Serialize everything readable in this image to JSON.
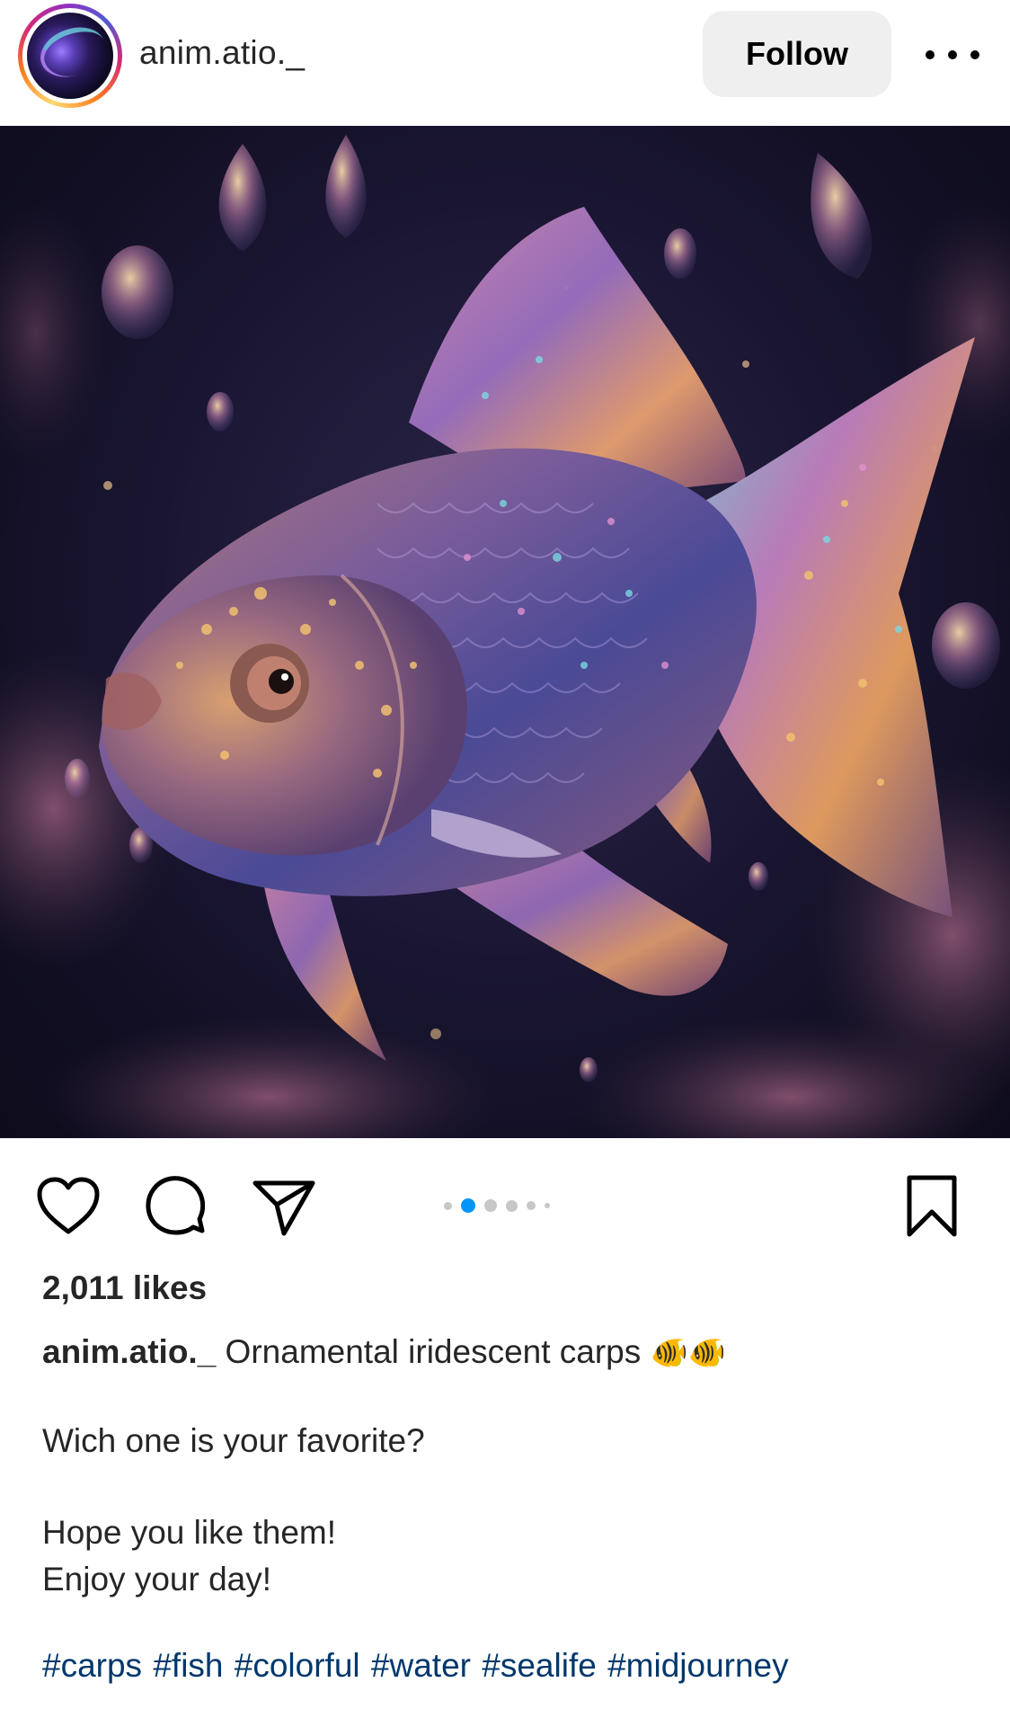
{
  "header": {
    "username": "anim.atio._",
    "follow_label": "Follow"
  },
  "post": {
    "image_icon": "fish-image",
    "carousel": {
      "total_dots": 6,
      "active_index": 1
    },
    "likes_text": "2,011 likes",
    "caption": {
      "username": "anim.atio._",
      "text": " Ornamental iridescent carps ",
      "emoji": "🐠🐠",
      "line2": "Wich one is your favorite?",
      "line3": "Hope you like them!",
      "line4": "Enjoy your day!"
    },
    "hashtags": [
      "#carps",
      "#fish",
      "#colorful",
      "#water",
      "#sealife",
      "#midjourney"
    ]
  },
  "colors": {
    "link": "#00376b",
    "active_dot": "#0095f6",
    "inactive_dot": "#c7c7c7",
    "follow_bg": "#efefef"
  },
  "icons": [
    "avatar",
    "more-icon",
    "heart-icon",
    "comment-icon",
    "share-icon",
    "bookmark-icon"
  ]
}
